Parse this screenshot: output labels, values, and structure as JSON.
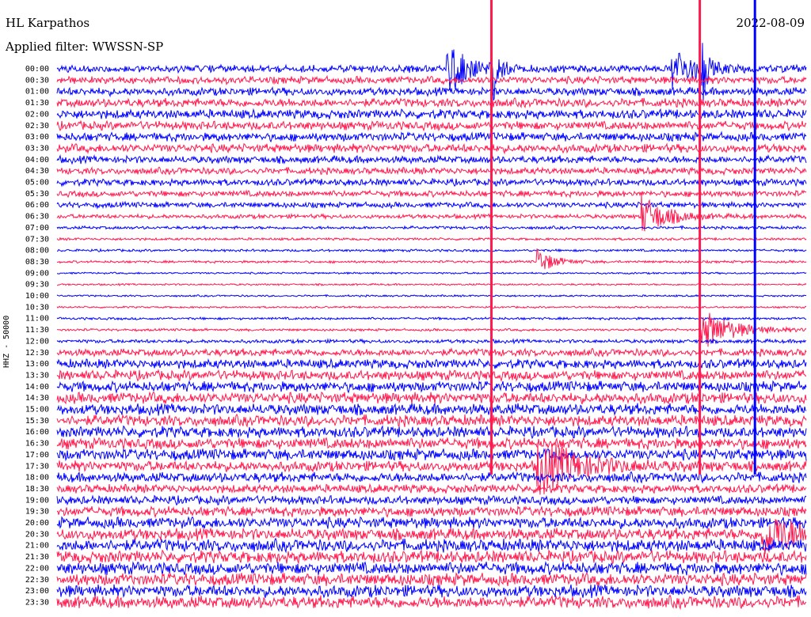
{
  "header": {
    "station": "HL Karpathos",
    "filter_label": "Applied filter: WWSSN-SP",
    "date": "2022-08-09"
  },
  "chart_data": {
    "type": "line",
    "title": "HL Karpathos",
    "subtitle": "Applied filter: WWSSN-SP",
    "ylabel": "HHZ - 50000",
    "date": "2022-08-09",
    "rows": [
      "00:00",
      "00:30",
      "01:00",
      "01:30",
      "02:00",
      "02:30",
      "03:00",
      "03:30",
      "04:00",
      "04:30",
      "05:00",
      "05:30",
      "06:00",
      "06:30",
      "07:00",
      "07:30",
      "08:00",
      "08:30",
      "09:00",
      "09:30",
      "10:00",
      "10:30",
      "11:00",
      "11:30",
      "12:00",
      "12:30",
      "13:00",
      "13:30",
      "14:00",
      "14:30",
      "15:00",
      "15:30",
      "16:00",
      "16:30",
      "17:00",
      "17:30",
      "18:00",
      "18:30",
      "19:00",
      "19:30",
      "20:00",
      "20:30",
      "21:00",
      "21:30",
      "22:00",
      "22:30",
      "23:00",
      "23:30"
    ],
    "row_minutes": 30,
    "series_colors": [
      "#0000ff",
      "#ff1a4f"
    ],
    "noise_amplitude": [
      0.6,
      0.6,
      0.65,
      0.7,
      0.75,
      0.7,
      0.7,
      0.7,
      0.6,
      0.55,
      0.55,
      0.5,
      0.45,
      0.35,
      0.25,
      0.2,
      0.2,
      0.2,
      0.15,
      0.15,
      0.15,
      0.15,
      0.2,
      0.2,
      0.3,
      0.6,
      0.75,
      0.8,
      0.85,
      0.9,
      0.9,
      0.9,
      0.9,
      0.9,
      0.9,
      0.85,
      0.8,
      0.7,
      0.7,
      0.8,
      0.9,
      0.95,
      1.0,
      1.0,
      1.0,
      1.0,
      1.0,
      1.0
    ],
    "events": [
      {
        "row": 0,
        "pos": 0.52,
        "amp": 3.5,
        "decay": 0.03
      },
      {
        "row": 0,
        "pos": 0.58,
        "amp": 8.0,
        "decay": 0.005
      },
      {
        "row": 0,
        "pos": 0.82,
        "amp": 3.0,
        "decay": 0.03
      },
      {
        "row": 0,
        "pos": 0.86,
        "amp": 6.0,
        "decay": 0.005
      },
      {
        "row": 13,
        "pos": 0.78,
        "amp": 3.0,
        "decay": 0.03
      },
      {
        "row": 17,
        "pos": 0.64,
        "amp": 2.0,
        "decay": 0.02
      },
      {
        "row": 23,
        "pos": 0.86,
        "amp": 3.0,
        "decay": 0.04
      },
      {
        "row": 35,
        "pos": 0.64,
        "amp": 4.0,
        "decay": 0.05
      },
      {
        "row": 41,
        "pos": 0.94,
        "amp": 3.0,
        "decay": 0.05
      }
    ],
    "vertical_lines": [
      {
        "x": 0.5798,
        "color": "#ff1a4f"
      },
      {
        "x": 0.8579,
        "color": "#ff1a4f"
      },
      {
        "x": 0.9315,
        "color": "#0000ff"
      }
    ],
    "grid": false
  }
}
